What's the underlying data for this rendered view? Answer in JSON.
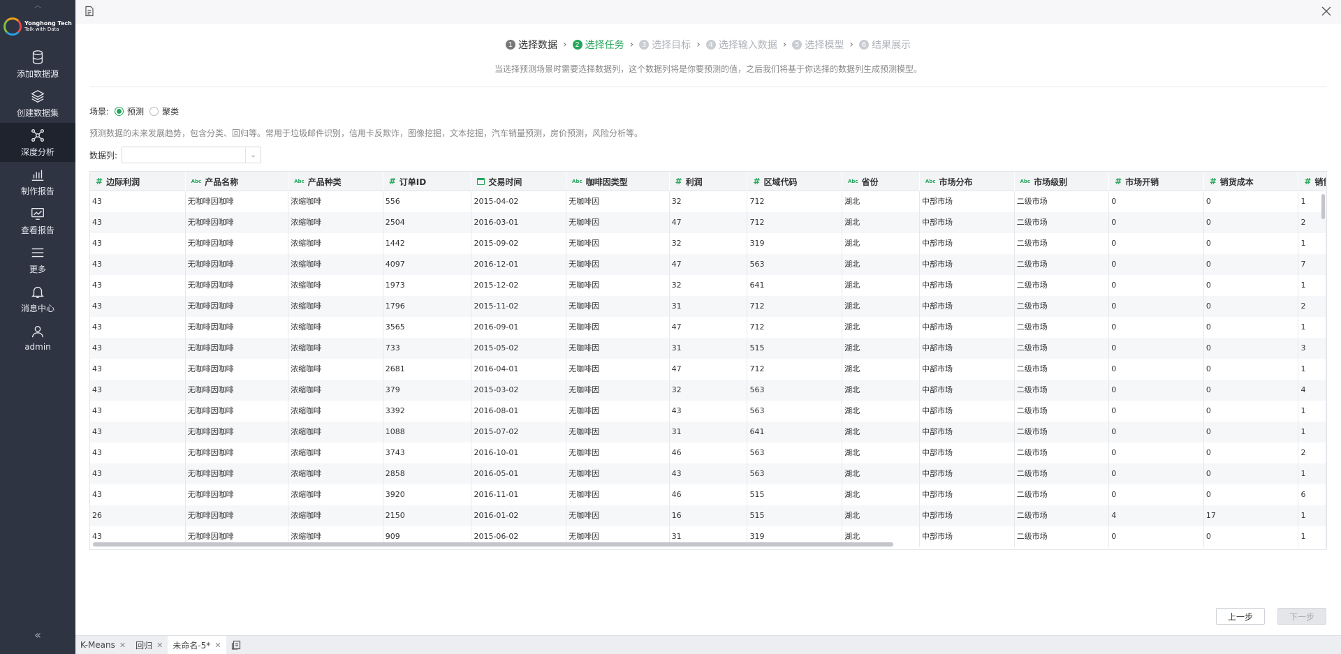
{
  "sidebar": {
    "logo": {
      "line1": "Yonghong Tech",
      "line2": "Talk with Data"
    },
    "items": [
      {
        "label": "添加数据源",
        "icon": "database-icon"
      },
      {
        "label": "创建数据集",
        "icon": "layers-icon"
      },
      {
        "label": "深度分析",
        "icon": "network-icon"
      },
      {
        "label": "制作报告",
        "icon": "bar-chart-icon"
      },
      {
        "label": "查看报告",
        "icon": "line-chart-icon"
      },
      {
        "label": "更多",
        "icon": "menu-icon"
      },
      {
        "label": "消息中心",
        "icon": "bell-icon"
      },
      {
        "label": "admin",
        "icon": "user-icon"
      }
    ],
    "collapse": "«"
  },
  "steps": [
    {
      "num": "1",
      "label": "选择数据",
      "state": "done"
    },
    {
      "num": "2",
      "label": "选择任务",
      "state": "current"
    },
    {
      "num": "3",
      "label": "选择目标",
      "state": "todo"
    },
    {
      "num": "4",
      "label": "选择输入数据",
      "state": "todo"
    },
    {
      "num": "5",
      "label": "选择模型",
      "state": "todo"
    },
    {
      "num": "6",
      "label": "结果展示",
      "state": "todo"
    }
  ],
  "hint": "当选择预测场景时需要选择数据列，这个数据列将是你要预测的值，之后我们将基于你选择的数据列生成预测模型。",
  "scene": {
    "label": "场景:",
    "options": [
      {
        "label": "预测",
        "checked": true
      },
      {
        "label": "聚类",
        "checked": false
      }
    ]
  },
  "description": "预测数据的未来发展趋势，包含分类、回归等。常用于垃圾邮件识别，信用卡反欺诈，图像挖掘，文本挖掘，汽车销量预测，房价预测，风险分析等。",
  "column_select": {
    "label": "数据列:",
    "value": ""
  },
  "table": {
    "columns": [
      {
        "name": "边际利润",
        "type": "number"
      },
      {
        "name": "产品名称",
        "type": "text"
      },
      {
        "name": "产品种类",
        "type": "text"
      },
      {
        "name": "订单ID",
        "type": "number"
      },
      {
        "name": "交易时间",
        "type": "date"
      },
      {
        "name": "咖啡因类型",
        "type": "text"
      },
      {
        "name": "利润",
        "type": "number"
      },
      {
        "name": "区域代码",
        "type": "number"
      },
      {
        "name": "省份",
        "type": "text"
      },
      {
        "name": "市场分布",
        "type": "text"
      },
      {
        "name": "市场级别",
        "type": "text"
      },
      {
        "name": "市场开销",
        "type": "number"
      },
      {
        "name": "销货成本",
        "type": "number"
      },
      {
        "name": "销售",
        "type": "number"
      }
    ],
    "rows": [
      [
        "43",
        "无咖啡因咖啡",
        "浓缩咖啡",
        "556",
        "2015-04-02",
        "无咖啡因",
        "32",
        "712",
        "湖北",
        "中部市场",
        "二级市场",
        "0",
        "0",
        "1"
      ],
      [
        "43",
        "无咖啡因咖啡",
        "浓缩咖啡",
        "2504",
        "2016-03-01",
        "无咖啡因",
        "47",
        "712",
        "湖北",
        "中部市场",
        "二级市场",
        "0",
        "0",
        "2"
      ],
      [
        "43",
        "无咖啡因咖啡",
        "浓缩咖啡",
        "1442",
        "2015-09-02",
        "无咖啡因",
        "32",
        "319",
        "湖北",
        "中部市场",
        "二级市场",
        "0",
        "0",
        "1"
      ],
      [
        "43",
        "无咖啡因咖啡",
        "浓缩咖啡",
        "4097",
        "2016-12-01",
        "无咖啡因",
        "47",
        "563",
        "湖北",
        "中部市场",
        "二级市场",
        "0",
        "0",
        "7"
      ],
      [
        "43",
        "无咖啡因咖啡",
        "浓缩咖啡",
        "1973",
        "2015-12-02",
        "无咖啡因",
        "32",
        "641",
        "湖北",
        "中部市场",
        "二级市场",
        "0",
        "0",
        "1"
      ],
      [
        "43",
        "无咖啡因咖啡",
        "浓缩咖啡",
        "1796",
        "2015-11-02",
        "无咖啡因",
        "31",
        "712",
        "湖北",
        "中部市场",
        "二级市场",
        "0",
        "0",
        "2"
      ],
      [
        "43",
        "无咖啡因咖啡",
        "浓缩咖啡",
        "3565",
        "2016-09-01",
        "无咖啡因",
        "47",
        "712",
        "湖北",
        "中部市场",
        "二级市场",
        "0",
        "0",
        "1"
      ],
      [
        "43",
        "无咖啡因咖啡",
        "浓缩咖啡",
        "733",
        "2015-05-02",
        "无咖啡因",
        "31",
        "515",
        "湖北",
        "中部市场",
        "二级市场",
        "0",
        "0",
        "3"
      ],
      [
        "43",
        "无咖啡因咖啡",
        "浓缩咖啡",
        "2681",
        "2016-04-01",
        "无咖啡因",
        "47",
        "712",
        "湖北",
        "中部市场",
        "二级市场",
        "0",
        "0",
        "1"
      ],
      [
        "43",
        "无咖啡因咖啡",
        "浓缩咖啡",
        "379",
        "2015-03-02",
        "无咖啡因",
        "32",
        "563",
        "湖北",
        "中部市场",
        "二级市场",
        "0",
        "0",
        "4"
      ],
      [
        "43",
        "无咖啡因咖啡",
        "浓缩咖啡",
        "3392",
        "2016-08-01",
        "无咖啡因",
        "43",
        "563",
        "湖北",
        "中部市场",
        "二级市场",
        "0",
        "0",
        "1"
      ],
      [
        "43",
        "无咖啡因咖啡",
        "浓缩咖啡",
        "1088",
        "2015-07-02",
        "无咖啡因",
        "31",
        "641",
        "湖北",
        "中部市场",
        "二级市场",
        "0",
        "0",
        "1"
      ],
      [
        "43",
        "无咖啡因咖啡",
        "浓缩咖啡",
        "3743",
        "2016-10-01",
        "无咖啡因",
        "46",
        "563",
        "湖北",
        "中部市场",
        "二级市场",
        "0",
        "0",
        "2"
      ],
      [
        "43",
        "无咖啡因咖啡",
        "浓缩咖啡",
        "2858",
        "2016-05-01",
        "无咖啡因",
        "43",
        "563",
        "湖北",
        "中部市场",
        "二级市场",
        "0",
        "0",
        "1"
      ],
      [
        "43",
        "无咖啡因咖啡",
        "浓缩咖啡",
        "3920",
        "2016-11-01",
        "无咖啡因",
        "46",
        "515",
        "湖北",
        "中部市场",
        "二级市场",
        "0",
        "0",
        "6"
      ],
      [
        "26",
        "无咖啡因咖啡",
        "浓缩咖啡",
        "2150",
        "2016-01-02",
        "无咖啡因",
        "16",
        "515",
        "湖北",
        "中部市场",
        "二级市场",
        "4",
        "17",
        "1"
      ],
      [
        "43",
        "无咖啡因咖啡",
        "浓缩咖啡",
        "909",
        "2015-06-02",
        "无咖啡因",
        "31",
        "319",
        "湖北",
        "中部市场",
        "二级市场",
        "0",
        "0",
        "1"
      ]
    ]
  },
  "buttons": {
    "prev": "上一步",
    "next": "下一步"
  },
  "tabs": [
    {
      "label": "K-Means",
      "active": false
    },
    {
      "label": "回归",
      "active": false
    },
    {
      "label": "未命名-5*",
      "active": true
    }
  ],
  "colors": {
    "accent": "#26a65b",
    "sidebar": "#2f3442"
  }
}
